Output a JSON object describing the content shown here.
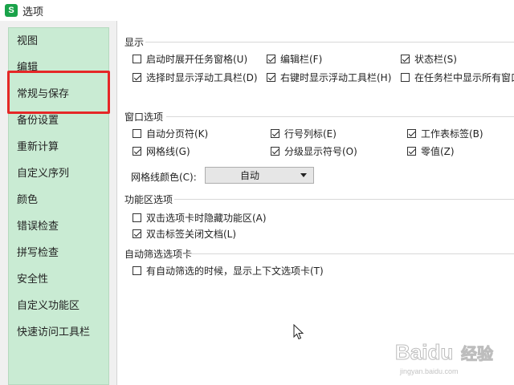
{
  "window": {
    "title": "选项",
    "logo_letter": "S"
  },
  "sidebar": {
    "items": [
      {
        "label": "视图"
      },
      {
        "label": "编辑"
      },
      {
        "label": "常规与保存"
      },
      {
        "label": "备份设置"
      },
      {
        "label": "重新计算"
      },
      {
        "label": "自定义序列"
      },
      {
        "label": "颜色"
      },
      {
        "label": "错误检查"
      },
      {
        "label": "拼写检查"
      },
      {
        "label": "安全性"
      },
      {
        "label": "自定义功能区"
      },
      {
        "label": "快速访问工具栏"
      }
    ],
    "selected": "编辑"
  },
  "display": {
    "title": "显示",
    "options": [
      {
        "label": "启动时展开任务窗格(U)",
        "checked": false
      },
      {
        "label": "编辑栏(F)",
        "checked": true
      },
      {
        "label": "状态栏(S)",
        "checked": true
      },
      {
        "label": "选择时显示浮动工具栏(D)",
        "checked": true
      },
      {
        "label": "右键时显示浮动工具栏(H)",
        "checked": true
      },
      {
        "label": "在任务栏中显示所有窗口",
        "checked": false
      }
    ]
  },
  "window_options": {
    "title": "窗口选项",
    "options": [
      {
        "label": "自动分页符(K)",
        "checked": false
      },
      {
        "label": "行号列标(E)",
        "checked": true
      },
      {
        "label": "工作表标签(B)",
        "checked": true
      },
      {
        "label": "网格线(G)",
        "checked": true
      },
      {
        "label": "分级显示符号(O)",
        "checked": true
      },
      {
        "label": "零值(Z)",
        "checked": true
      }
    ],
    "gridline_color_label": "网格线颜色(C):",
    "gridline_color_value": "自动"
  },
  "ribbon": {
    "title": "功能区选项",
    "options": [
      {
        "label": "双击选项卡时隐藏功能区(A)",
        "checked": false
      },
      {
        "label": "双击标签关闭文档(L)",
        "checked": true
      }
    ]
  },
  "autofilter": {
    "title": "自动筛选选项卡",
    "options": [
      {
        "label": "有自动筛选的时候，显示上下文选项卡(T)",
        "checked": false
      }
    ]
  },
  "watermark": {
    "brand": "Baidu",
    "text": "经验",
    "url": "jingyan.baidu.com"
  },
  "colors": {
    "highlight": "#e52727",
    "sidebar_bg": "#c9ebd3",
    "logo": "#1aa34a"
  }
}
